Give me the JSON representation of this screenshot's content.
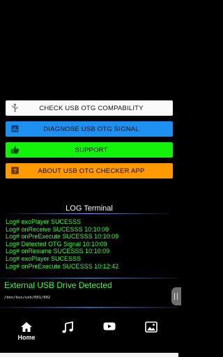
{
  "buttons": [
    {
      "label": "CHECK USB OTG COMPABILITY",
      "icon": "usb-icon"
    },
    {
      "label": "DIAGNOSE USB OTG SIGNAL",
      "icon": "chart-icon"
    },
    {
      "label": "SUPPORT",
      "icon": "thumbs-up-icon"
    },
    {
      "label": "ABOUT USB OTG CHECKER APP",
      "icon": "help-icon"
    }
  ],
  "colors": {
    "check": "#fafafa",
    "diagnose": "#1e90f0",
    "support": "#12f20a",
    "about": "#ff9a00",
    "log_text": "#35ff35"
  },
  "terminal": {
    "title": "LOG Terminal",
    "lines": [
      "Log# exoPlayer  SUCESSS",
      "Log# onReceive  SUCESSS  10:10:09",
      "Log# onPreExecute  SUCESSS  10:10:09",
      "Log# Detected OTG Signal  10:10:09",
      "Log# onResume  SUCESSS  10:10:09",
      "Log# exoPlayer  SUCESSS",
      "Log# onPreExecute  SUCESSS  10:12:42"
    ]
  },
  "status": {
    "detected": "External USB Drive Detected",
    "device_path": "/dev/bus/usb/001/002"
  },
  "nav": {
    "home_label": "Home",
    "items": [
      "home-icon",
      "music-icon",
      "youtube-icon",
      "gallery-icon"
    ]
  }
}
